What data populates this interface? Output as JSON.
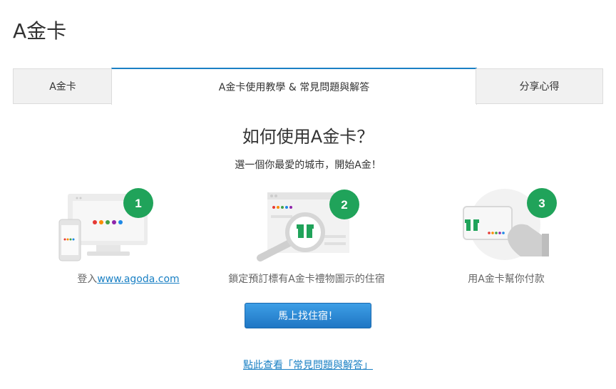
{
  "page": {
    "title": "A金卡"
  },
  "tabs": [
    {
      "label": "A金卡"
    },
    {
      "label": "A金卡使用教學 & 常見問題與解答"
    },
    {
      "label": "分享心得"
    }
  ],
  "main": {
    "headline": "如何使用A金卡？",
    "subheadline": "選一個你最愛的城市，開始A金！",
    "steps": [
      {
        "number": "1",
        "caption_prefix": "登入",
        "caption_link": "www.agoda.com",
        "icon": "devices-icon"
      },
      {
        "number": "2",
        "caption": "鎖定預訂標有A金卡禮物圖示的住宿",
        "icon": "magnifier-gift-icon"
      },
      {
        "number": "3",
        "caption": "用A金卡幫你付款",
        "icon": "card-hand-icon"
      }
    ],
    "cta_label": "馬上找住宿！",
    "faq_link": "點此查看「常見問題與解答」"
  },
  "colors": {
    "accent": "#1a80c4",
    "badge": "#20a35a",
    "button": "#2a86d2"
  }
}
